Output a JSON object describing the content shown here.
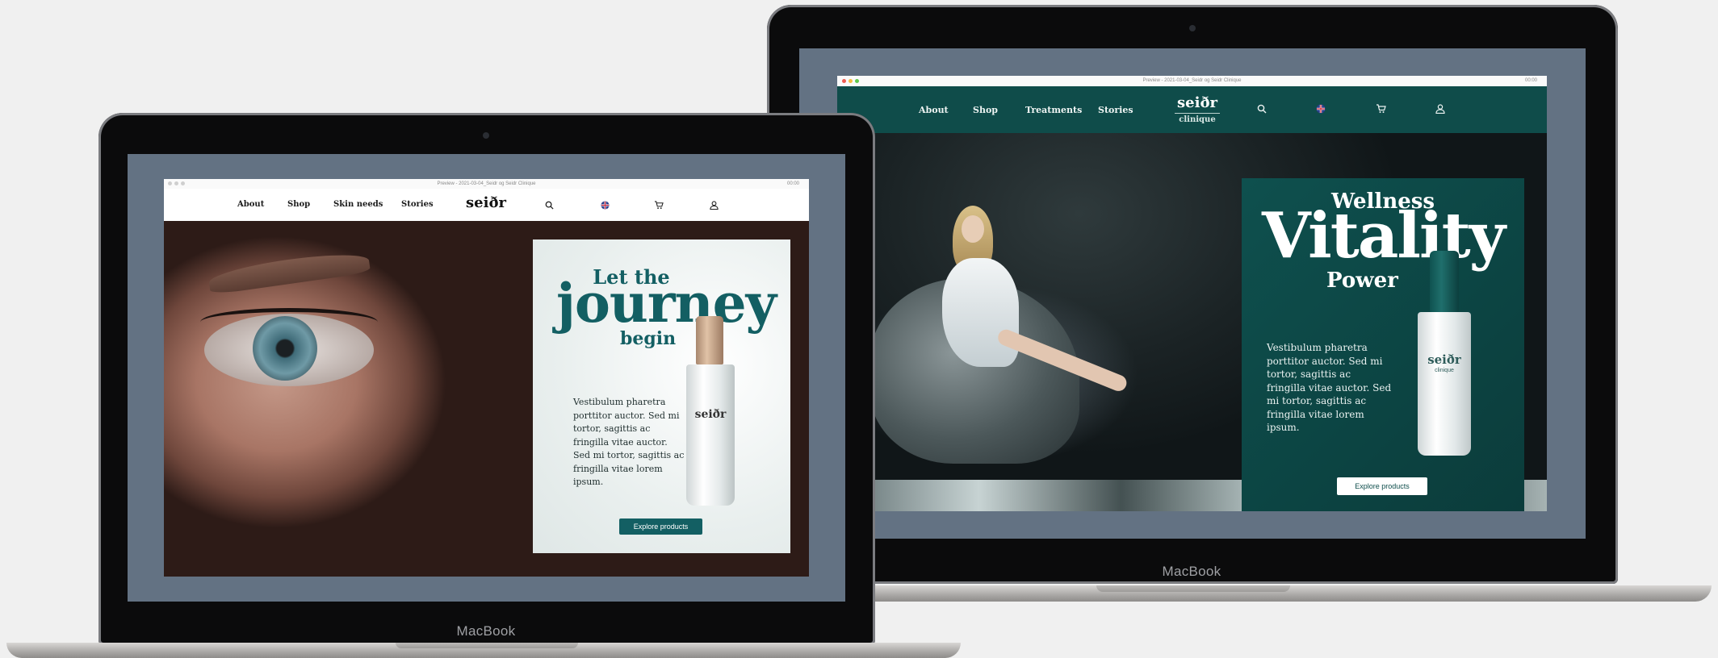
{
  "left_device": {
    "brand_label": "MacBook",
    "browser": {
      "title": "Preview - 2021-03-04_Seidr og Seidr Clinique",
      "status": "00:00"
    },
    "nav": {
      "items": [
        "About",
        "Shop",
        "Skin needs",
        "Stories"
      ],
      "logo": "seiðr"
    },
    "hero": {
      "headline_top": "Let the",
      "headline_main": "journey",
      "headline_bottom": "begin",
      "body": "Vestibulum pharetra porttitor auctor. Sed mi tortor, sagittis ac fringilla vitae auctor. Sed mi tortor, sagittis ac fringilla vitae lorem ipsum.",
      "cta": "Explore products",
      "product_brand": "seiðr"
    },
    "colors": {
      "accent": "#135f63",
      "card_bg": "#eef2f1"
    }
  },
  "right_device": {
    "brand_label": "MacBook",
    "browser": {
      "title": "Preview - 2021-03-04_Seidr og Seidr Clinique",
      "status": "00:00"
    },
    "nav": {
      "items": [
        "About",
        "Shop",
        "Treatments",
        "Stories"
      ],
      "logo": "seiðr",
      "logo_sub": "clinique"
    },
    "hero": {
      "headline_top": "Wellness",
      "headline_main": "Vitality",
      "headline_bottom": "Power",
      "body": "Vestibulum pharetra porttitor auctor. Sed mi tortor, sagittis ac fringilla vitae auctor. Sed mi tortor, sagittis ac fringilla vitae lorem ipsum.",
      "cta": "Explore products",
      "product_brand": "seiðr",
      "product_sub": "clinique"
    },
    "colors": {
      "accent": "#0f4e4c",
      "nav_bg": "#0f4c4a"
    }
  },
  "icons": [
    "search-icon",
    "language-flag-icon",
    "cart-icon",
    "account-icon"
  ]
}
